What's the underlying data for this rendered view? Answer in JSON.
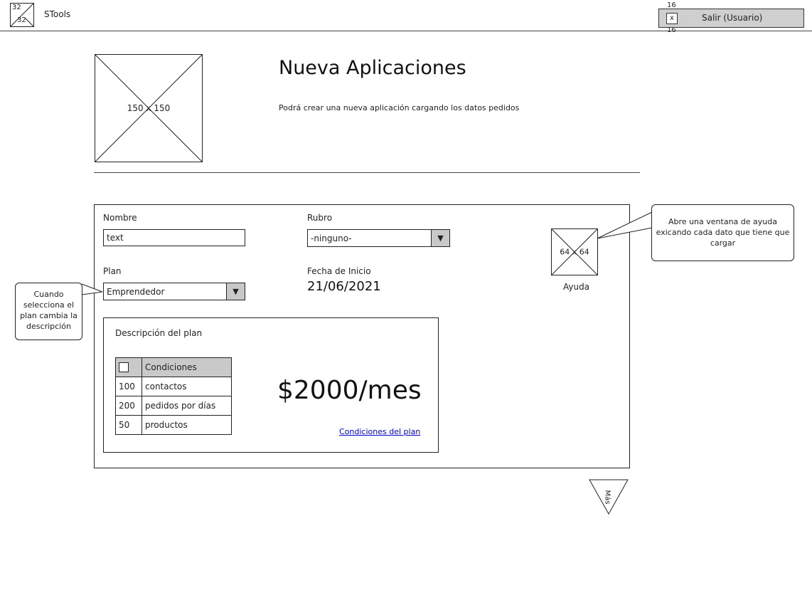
{
  "topbar": {
    "logo_top": "32",
    "logo_bottom": "32",
    "app_name": "STools",
    "logout_label": "Salir (Usuario)",
    "logout_icon": "close-icon",
    "logout_icon_glyph": "x",
    "dim_top": "16",
    "dim_bottom": "16"
  },
  "header": {
    "image_label": "150 x 150",
    "title": "Nueva Aplicaciones",
    "subtitle": "Podrá crear una nueva aplicación cargando los datos pedidos"
  },
  "form": {
    "nombre_label": "Nombre",
    "nombre_value": "text",
    "rubro_label": "Rubro",
    "rubro_value": "-ninguno-",
    "plan_label": "Plan",
    "plan_value": "Emprendedor",
    "fecha_label": "Fecha de Inicio",
    "fecha_value": "21/06/2021",
    "dropdown_glyph": "▼",
    "help_image_label": "64 x 64",
    "help_label": "Ayuda"
  },
  "plan_description": {
    "title": "Descripción del plan",
    "table_header": "Condiciones",
    "rows": [
      {
        "num": "100",
        "desc": "contactos"
      },
      {
        "num": "200",
        "desc": "pedidos por días"
      },
      {
        "num": "50",
        "desc": "productos"
      }
    ],
    "price": "$2000/mes",
    "link": "Condiciones del plan"
  },
  "callouts": {
    "help": "Abre una ventana de ayuda exicando cada dato que tiene que cargar",
    "plan": "Cuando selecciona el plan cambia la descripción"
  },
  "more_label": "Más"
}
